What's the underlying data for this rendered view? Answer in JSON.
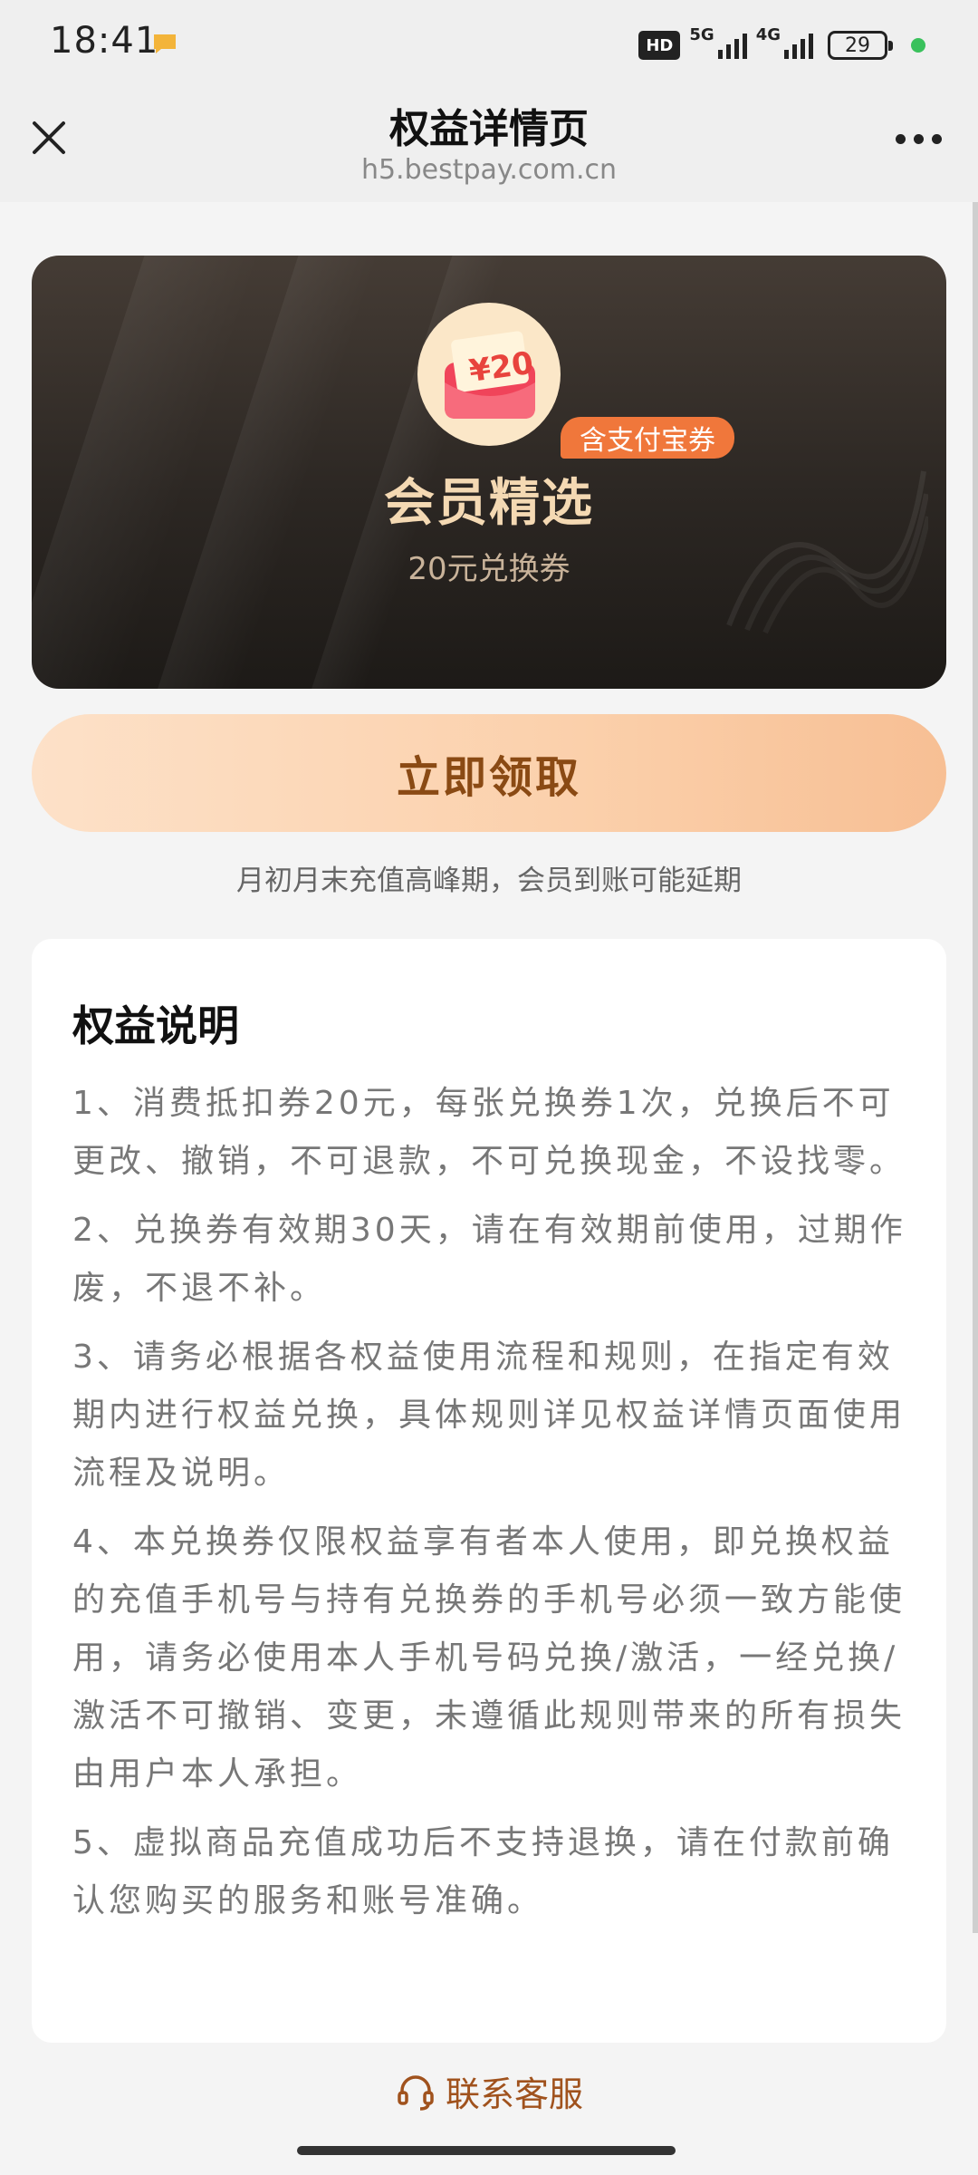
{
  "status_bar": {
    "time": "18:41",
    "hd_label": "HD",
    "network_1": "5G",
    "network_2": "4G",
    "battery": "29"
  },
  "titlebar": {
    "title": "权益详情页",
    "url": "h5.bestpay.com.cn"
  },
  "hero": {
    "coupon_amount": "¥20",
    "tag": "含支付宝券",
    "title": "会员精选",
    "subtitle": "20元兑换券"
  },
  "claim_button": "立即领取",
  "notice": "月初月末充值高峰期，会员到账可能延期",
  "rules": {
    "title": "权益说明",
    "items": [
      "1、消费抵扣券20元，每张兑换券1次，兑换后不可更改、撤销，不可退款，不可兑换现金，不设找零。",
      "2、兑换券有效期30天，请在有效期前使用，过期作废，不退不补。",
      "3、请务必根据各权益使用流程和规则，在指定有效期内进行权益兑换，具体规则详见权益详情页面使用流程及说明。",
      "4、本兑换券仅限权益享有者本人使用，即兑换权益的充值手机号与持有兑换券的手机号必须一致方能使用，请务必使用本人手机号码兑换/激活，一经兑换/激活不可撤销、变更，未遵循此规则带来的所有损失由用户本人承担。",
      "5、虚拟商品充值成功后不支持退换，请在付款前确认您购买的服务和账号准确。"
    ]
  },
  "contact": "联系客服",
  "colors": {
    "accent_orange": "#f0773b",
    "button_text": "#8a4a14",
    "hero_title": "#f4d9b3"
  },
  "icons": {
    "close": "close-icon",
    "more": "more-icon",
    "headset": "headset-icon",
    "coupon": "red-envelope-coupon-icon"
  }
}
